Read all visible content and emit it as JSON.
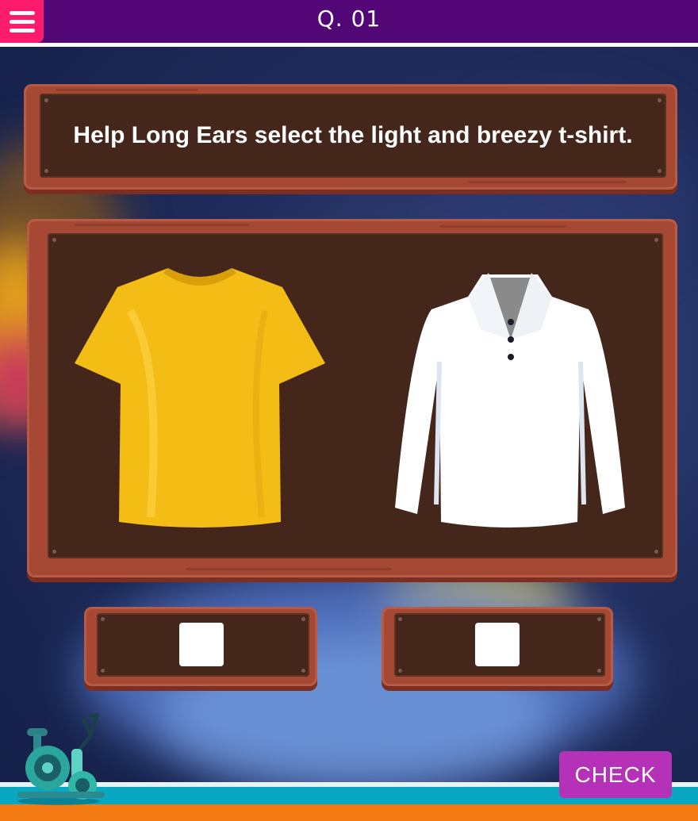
{
  "header": {
    "question_number": "Q. 01"
  },
  "question": {
    "text": "Help Long Ears select the light and breezy t-shirt."
  },
  "options": [
    {
      "item": "yellow-tshirt",
      "color": "#f7c51c",
      "checked": false
    },
    {
      "item": "white-shirt",
      "color": "#ffffff",
      "checked": false
    }
  ],
  "check_button": {
    "label": "CHECK",
    "color": "#b532b8"
  },
  "colors": {
    "topbar": "#530675",
    "menu_button": "#ff1b6b",
    "board_wood": "#a54935",
    "board_inner": "#45261b"
  },
  "icons": [
    "menu-icon",
    "exercise-bike-icon"
  ]
}
